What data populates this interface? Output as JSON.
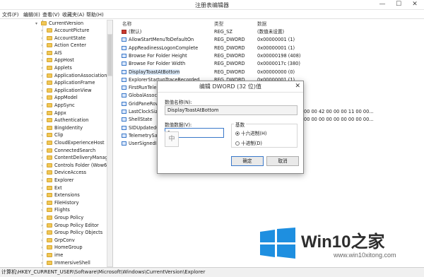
{
  "window": {
    "title": "注册表编辑器",
    "minimize": "—",
    "maximize": "☐",
    "close": "✕"
  },
  "menu": [
    "文件(F)",
    "编辑(E)",
    "查看(V)",
    "收藏夹(A)",
    "帮助(H)"
  ],
  "tree": {
    "root": "CurrentVersion",
    "items": [
      "AccountPicture",
      "AccountState",
      "Action Center",
      "AIS",
      "AppHost",
      "Applets",
      "ApplicationAssociationTo",
      "ApplicationFrame",
      "ApplicationView",
      "AppModel",
      "AppSync",
      "Appx",
      "Authentication",
      "BingIdentity",
      "Clip",
      "CloudExperienceHost",
      "ConnectedSearch",
      "ContentDeliveryManager",
      "Controls Folder (Wow64)",
      "DeviceAccess",
      "Explorer",
      "Ext",
      "Extensions",
      "FileHistory",
      "Flights",
      "Group Policy",
      "Group Policy Editor",
      "Group Policy Objects",
      "GrpConv",
      "HomeGroup",
      "ime",
      "ImmersiveShell"
    ]
  },
  "list": {
    "headers": {
      "name": "名称",
      "type": "类型",
      "data": "数据"
    },
    "rows": [
      {
        "name": "(默认)",
        "type": "REG_SZ",
        "data": "(数值未设置)",
        "icon": "ab"
      },
      {
        "name": "AllowStartMenuToDefaultOn",
        "type": "REG_DWORD",
        "data": "0x00000001 (1)",
        "icon": "dword"
      },
      {
        "name": "AppReadinessLogonComplete",
        "type": "REG_DWORD",
        "data": "0x00000001 (1)",
        "icon": "dword"
      },
      {
        "name": "Browse For Folder Height",
        "type": "REG_DWORD",
        "data": "0x00000198 (408)",
        "icon": "dword"
      },
      {
        "name": "Browse For Folder Width",
        "type": "REG_DWORD",
        "data": "0x0000017c (380)",
        "icon": "dword"
      },
      {
        "name": "DisplayToastAtBottom",
        "type": "REG_DWORD",
        "data": "0x00000000 (0)",
        "icon": "dword"
      },
      {
        "name": "ExplorerStartupTraceRecorded",
        "type": "REG_DWORD",
        "data": "0x00000001 (1)",
        "icon": "dword"
      },
      {
        "name": "FirstRunTelemet",
        "type": "",
        "data": "",
        "icon": "dword"
      },
      {
        "name": "GlobalAssocCh",
        "type": "",
        "data": "",
        "icon": "dword"
      },
      {
        "name": "GridPaneRowC",
        "type": "",
        "data": "",
        "icon": "dword"
      },
      {
        "name": "LastClockSize",
        "type": "",
        "data": "00 00 42 00 00 00 11 00 00...",
        "icon": "bin"
      },
      {
        "name": "ShellState",
        "type": "",
        "data": "00 00 00 00 00 00 00 00 00...",
        "icon": "bin"
      },
      {
        "name": "SIDUpdatedOn",
        "type": "",
        "data": "",
        "icon": "dword"
      },
      {
        "name": "TelemetrySalt",
        "type": "",
        "data": "",
        "icon": "dword"
      },
      {
        "name": "UserSignedIn",
        "type": "",
        "data": "",
        "icon": "dword"
      }
    ]
  },
  "dialog": {
    "title": "编辑 DWORD (32 位)值",
    "close": "✕",
    "name_label": "数值名称(N):",
    "name_value": "DisplayToastAtBottom",
    "data_label": "数值数据(V):",
    "data_value": "1",
    "base_label": "基数",
    "hex_label": "十六进制(H)",
    "dec_label": "十进制(D)",
    "ok": "确定",
    "cancel": "取消"
  },
  "cursor_glyph": "中",
  "status": "计算机\\HKEY_CURRENT_USER\\Software\\Microsoft\\Windows\\CurrentVersion\\Explorer",
  "watermark": {
    "brand": "Win10之家",
    "url": "www.win10xitong.com"
  },
  "colors": {
    "accent": "#3a78c9",
    "logo": "#1e8fe0"
  }
}
